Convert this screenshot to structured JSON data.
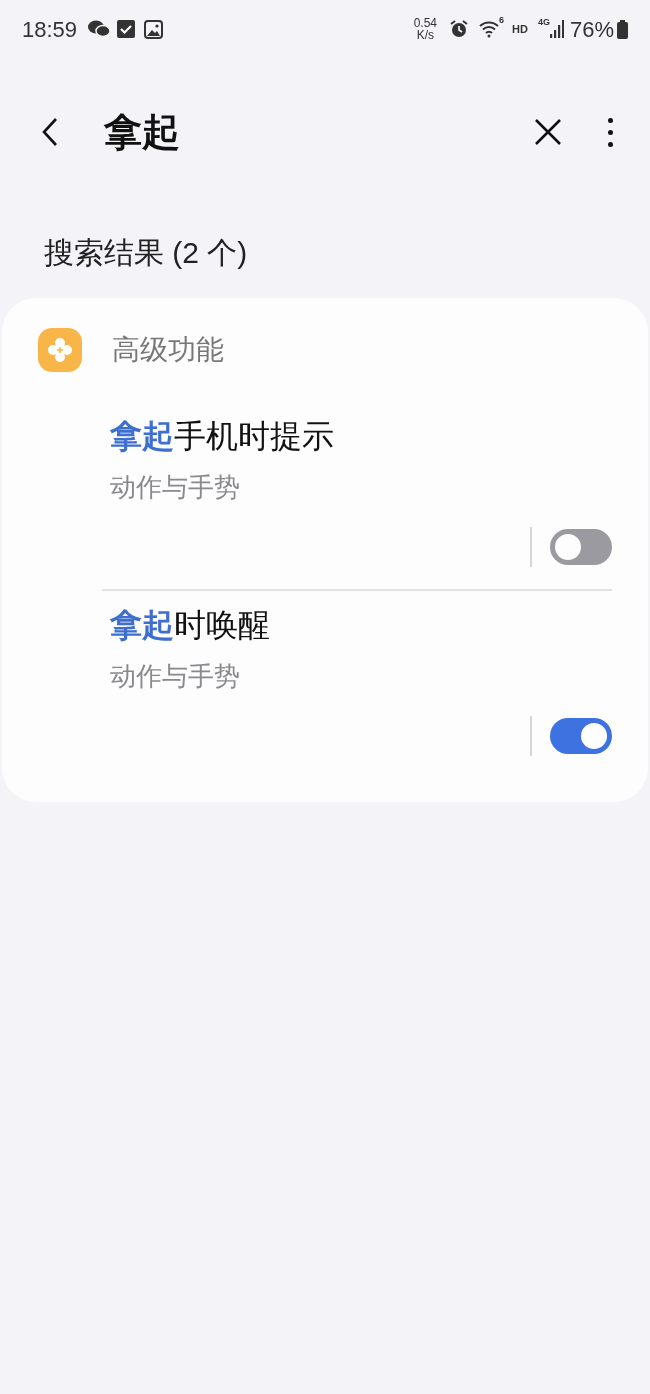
{
  "status_bar": {
    "time": "18:59",
    "speed_value": "0.54",
    "speed_unit": "K/s",
    "wifi_badge": "6",
    "hd": "HD",
    "network": "4G",
    "battery": "76%"
  },
  "header": {
    "title": "拿起"
  },
  "results_heading": "搜索结果 (2 个)",
  "group": {
    "title": "高级功能",
    "items": [
      {
        "title": "**拿起**手机时提示",
        "subtitle": "动作与手势",
        "on": false
      },
      {
        "title": "**拿起**时唤醒",
        "subtitle": "动作与手势",
        "on": true
      }
    ]
  }
}
